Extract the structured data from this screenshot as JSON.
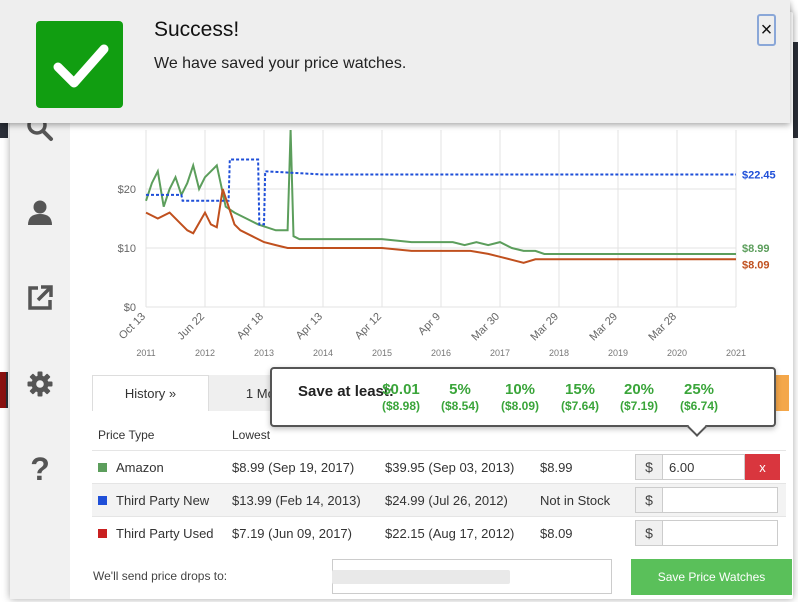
{
  "notification": {
    "title": "Success!",
    "message": "We have saved your price watches.",
    "close_label": "×"
  },
  "tabs": {
    "history_label": "History »",
    "month_label": "1 Mon"
  },
  "save_at_least": {
    "title": "Save at least:",
    "options": [
      {
        "label": "$0.01",
        "price": "($8.98)"
      },
      {
        "label": "5%",
        "price": "($8.54)"
      },
      {
        "label": "10%",
        "price": "($8.09)"
      },
      {
        "label": "15%",
        "price": "($7.64)"
      },
      {
        "label": "20%",
        "price": "($7.19)"
      },
      {
        "label": "25%",
        "price": "($6.74)"
      }
    ]
  },
  "table": {
    "headers": [
      "Price Type",
      "Lowest",
      "",
      "",
      ""
    ],
    "rows": [
      {
        "type": "Amazon",
        "color": "#5c9e5c",
        "lowest": "$8.99 (Sep 19, 2017)",
        "highest": "$39.95 (Sep 03, 2013)",
        "current": "$8.99",
        "watch": "6.00"
      },
      {
        "type": "Third Party New",
        "color": "#1f4fd8",
        "lowest": "$13.99 (Feb 14, 2013)",
        "highest": "$24.99 (Jul 26, 2012)",
        "current": "Not in Stock",
        "watch": ""
      },
      {
        "type": "Third Party Used",
        "color": "#c92020",
        "lowest": "$7.19 (Jun 09, 2017)",
        "highest": "$22.15 (Aug 17, 2012)",
        "current": "$8.09",
        "watch": ""
      }
    ],
    "currency_symbol": "$",
    "clear_label": "x"
  },
  "email": {
    "label": "We'll send price drops to:"
  },
  "save_button": "Save Price Watches",
  "colors": {
    "amazon": "#5c9e5c",
    "third_party_new": "#1f4fd8",
    "third_party_used": "#c0501e",
    "save_green": "#3aa53a",
    "button_green": "#5ac05a",
    "success_green": "#119e11"
  },
  "chart_data": {
    "type": "line",
    "y_ticks": [
      "$0",
      "$10",
      "$20"
    ],
    "ylim": [
      0,
      30
    ],
    "x_ticks": [
      {
        "label": "Oct 13",
        "year": "2011"
      },
      {
        "label": "Jun 22",
        "year": "2012"
      },
      {
        "label": "Apr 18",
        "year": "2013"
      },
      {
        "label": "Apr 13",
        "year": "2014"
      },
      {
        "label": "Apr 12",
        "year": "2015"
      },
      {
        "label": "Apr 9",
        "year": "2016"
      },
      {
        "label": "Mar 30",
        "year": "2017"
      },
      {
        "label": "Mar 29",
        "year": "2018"
      },
      {
        "label": "Mar 29",
        "year": "2019"
      },
      {
        "label": "Mar 28",
        "year": "2020"
      },
      {
        "label": "",
        "year": "2021"
      }
    ],
    "end_labels": [
      {
        "text": "$22.45",
        "color": "#1f4fd8",
        "value": 22.45
      },
      {
        "text": "$8.99",
        "color": "#5c9e5c",
        "value": 8.99
      },
      {
        "text": "$8.09",
        "color": "#c0501e",
        "value": 8.09
      }
    ],
    "series": [
      {
        "key": "amazon",
        "color": "#5c9e5c",
        "points": [
          [
            0,
            18
          ],
          [
            0.1,
            21
          ],
          [
            0.2,
            23
          ],
          [
            0.3,
            17
          ],
          [
            0.4,
            20
          ],
          [
            0.5,
            22
          ],
          [
            0.6,
            19
          ],
          [
            0.7,
            21
          ],
          [
            0.8,
            24
          ],
          [
            0.9,
            20
          ],
          [
            1.0,
            22
          ],
          [
            1.1,
            23
          ],
          [
            1.2,
            24
          ],
          [
            1.35,
            17
          ],
          [
            1.5,
            16
          ],
          [
            1.7,
            15
          ],
          [
            1.9,
            14
          ],
          [
            2.2,
            13
          ],
          [
            2.4,
            13
          ],
          [
            2.45,
            40
          ],
          [
            2.5,
            12
          ],
          [
            2.6,
            11.5
          ],
          [
            3.0,
            11.5
          ],
          [
            4.0,
            11.5
          ],
          [
            4.5,
            11
          ],
          [
            5.0,
            11
          ],
          [
            5.2,
            11
          ],
          [
            5.4,
            10.5
          ],
          [
            5.6,
            11
          ],
          [
            5.8,
            10.5
          ],
          [
            6.0,
            11
          ],
          [
            6.2,
            10
          ],
          [
            6.4,
            9.5
          ],
          [
            6.6,
            9.5
          ],
          [
            6.75,
            8.99
          ],
          [
            10.0,
            8.99
          ]
        ]
      },
      {
        "key": "third_party_new",
        "color": "#1f4fd8",
        "points": [
          [
            0,
            19
          ],
          [
            0.6,
            19
          ],
          [
            0.62,
            18
          ],
          [
            1.4,
            18
          ],
          [
            1.42,
            25
          ],
          [
            1.9,
            25
          ],
          [
            1.92,
            14
          ],
          [
            2.0,
            14
          ],
          [
            2.02,
            23
          ],
          [
            3.0,
            22.45
          ],
          [
            10.0,
            22.45
          ]
        ]
      },
      {
        "key": "third_party_used",
        "color": "#c0501e",
        "points": [
          [
            0,
            16
          ],
          [
            0.2,
            15
          ],
          [
            0.4,
            16
          ],
          [
            0.6,
            14
          ],
          [
            0.7,
            13
          ],
          [
            0.8,
            12.5
          ],
          [
            1.0,
            16
          ],
          [
            1.1,
            14
          ],
          [
            1.2,
            13.5
          ],
          [
            1.3,
            20
          ],
          [
            1.4,
            17
          ],
          [
            1.5,
            14
          ],
          [
            1.6,
            13
          ],
          [
            1.8,
            12
          ],
          [
            2.0,
            11
          ],
          [
            2.2,
            10.5
          ],
          [
            2.4,
            10
          ],
          [
            2.6,
            10
          ],
          [
            3.0,
            10
          ],
          [
            3.5,
            10
          ],
          [
            4.0,
            10
          ],
          [
            4.5,
            9.5
          ],
          [
            5.0,
            9.5
          ],
          [
            5.5,
            9.5
          ],
          [
            5.8,
            9
          ],
          [
            6.0,
            8.5
          ],
          [
            6.2,
            8
          ],
          [
            6.4,
            7.5
          ],
          [
            6.6,
            8.09
          ],
          [
            10.0,
            8.09
          ]
        ]
      }
    ]
  }
}
